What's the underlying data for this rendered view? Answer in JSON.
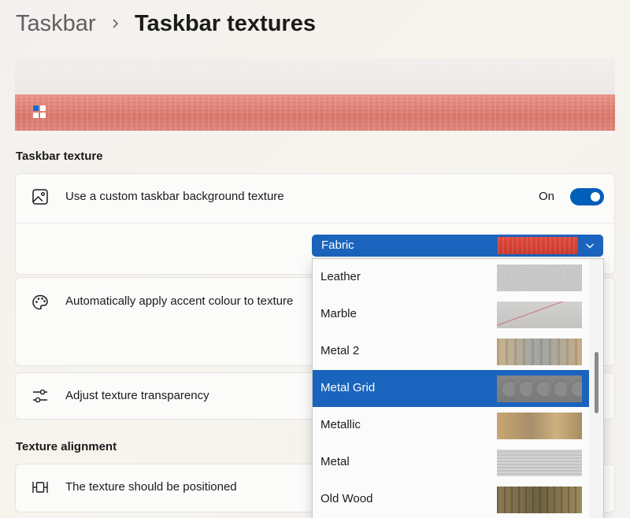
{
  "header": {
    "breadcrumb_root": "Taskbar",
    "breadcrumb_current": "Taskbar textures"
  },
  "sections": {
    "taskbar_texture": "Taskbar texture",
    "texture_alignment": "Texture alignment"
  },
  "settings": {
    "custom_texture": {
      "label": "Use a custom taskbar background texture",
      "toggle_state": "On",
      "toggle_on": true
    },
    "accent_colour": {
      "label": "Automatically apply accent colour to texture"
    },
    "transparency": {
      "label": "Adjust texture transparency"
    },
    "alignment": {
      "label": "The texture should be positioned"
    }
  },
  "texture_select": {
    "selected": "Fabric",
    "options": [
      {
        "label": "Leather",
        "selected": false
      },
      {
        "label": "Marble",
        "selected": false
      },
      {
        "label": "Metal 2",
        "selected": false
      },
      {
        "label": "Metal Grid",
        "selected": true
      },
      {
        "label": "Metallic",
        "selected": false
      },
      {
        "label": "Metal",
        "selected": false
      },
      {
        "label": "Old Wood",
        "selected": false
      }
    ]
  },
  "colors": {
    "accent": "#1a64bd",
    "toggle_on": "#005fb8",
    "texture_fabric": "#d9786d"
  }
}
